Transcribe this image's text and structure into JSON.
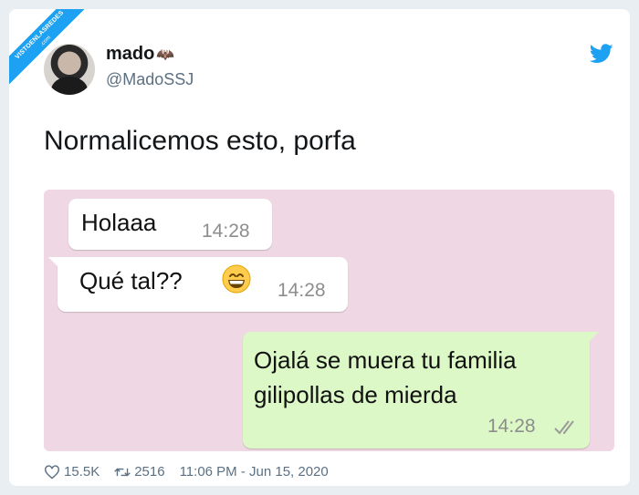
{
  "watermark": {
    "line1": "VISTOENLASREDES",
    "line2": ".com"
  },
  "author": {
    "name": "mado",
    "emoji": "🦇",
    "handle": "@MadoSSJ"
  },
  "icons": {
    "twitter": "twitter-bird-icon",
    "like": "heart-icon",
    "retweet": "retweet-icon",
    "read": "double-check-icon",
    "emoji": "grinning-face-icon"
  },
  "tweet": {
    "text": "Normalicemos esto, porfa"
  },
  "chat": {
    "messages": [
      {
        "direction": "incoming",
        "text": "Holaaa",
        "time": "14:28"
      },
      {
        "direction": "incoming",
        "text": "Qué tal??",
        "time": "14:28"
      },
      {
        "direction": "outgoing",
        "line1": "Ojalá se muera tu familia",
        "line2": "gilipollas de mierda",
        "time": "14:28"
      }
    ]
  },
  "stats": {
    "likes": "15.5K",
    "retweets": "2516",
    "timestamp": "11:06 PM - Jun 15, 2020"
  },
  "colors": {
    "twitter_blue": "#1da1f2",
    "chat_bg": "#efd8e3",
    "outgoing_bubble": "#dcf8c6",
    "incoming_bubble": "#ffffff"
  }
}
